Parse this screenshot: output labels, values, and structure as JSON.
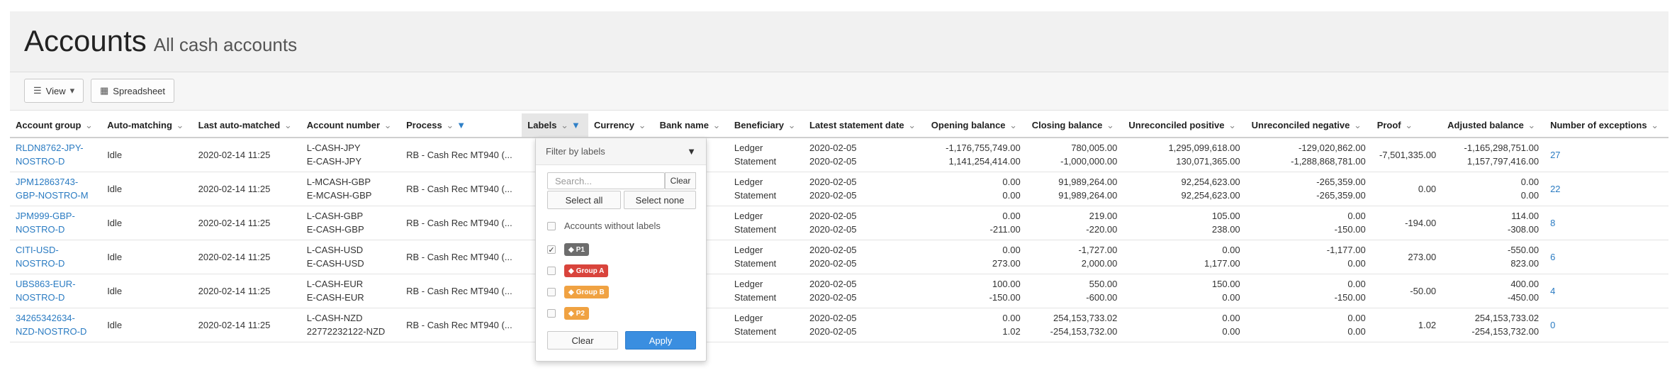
{
  "page": {
    "title": "Accounts",
    "subtitle": "All cash accounts"
  },
  "toolbar": {
    "view_label": "View",
    "spreadsheet_label": "Spreadsheet"
  },
  "columns": [
    "Account group",
    "Auto-matching",
    "Last auto-matched",
    "Account number",
    "Process",
    "Labels",
    "Currency",
    "Bank name",
    "Beneficiary",
    "Latest statement date",
    "Opening balance",
    "Closing balance",
    "Unreconciled positive",
    "Unreconciled negative",
    "Proof",
    "Adjusted balance",
    "Number of exceptions"
  ],
  "rows": [
    {
      "group": [
        "RLDN8762-JPY-",
        "NOSTRO-D"
      ],
      "auto": "Idle",
      "last": "2020-02-14 11:25",
      "acct": [
        "L-CASH-JPY",
        "E-CASH-JPY"
      ],
      "process": "RB - Cash Rec MT940 (...",
      "beneficiary": [
        "Ledger",
        "Statement"
      ],
      "date": [
        "2020-02-05",
        "2020-02-05"
      ],
      "opening": [
        "-1,176,755,749.00",
        "1,141,254,414.00"
      ],
      "closing": [
        "780,005.00",
        "-1,000,000.00"
      ],
      "upos": [
        "1,295,099,618.00",
        "130,071,365.00"
      ],
      "uneg": [
        "-129,020,862.00",
        "-1,288,868,781.00"
      ],
      "proof": "-7,501,335.00",
      "adjusted": [
        "-1,165,298,751.00",
        "1,157,797,416.00"
      ],
      "exceptions": "27"
    },
    {
      "group": [
        "JPM12863743-",
        "GBP-NOSTRO-M"
      ],
      "auto": "Idle",
      "last": "2020-02-14 11:25",
      "acct": [
        "L-MCASH-GBP",
        "E-MCASH-GBP"
      ],
      "process": "RB - Cash Rec MT940 (...",
      "beneficiary": [
        "Ledger",
        "Statement"
      ],
      "date": [
        "2020-02-05",
        "2020-02-05"
      ],
      "opening": [
        "0.00",
        "0.00"
      ],
      "closing": [
        "91,989,264.00",
        "91,989,264.00"
      ],
      "upos": [
        "92,254,623.00",
        "92,254,623.00"
      ],
      "uneg": [
        "-265,359.00",
        "-265,359.00"
      ],
      "proof": "0.00",
      "adjusted": [
        "0.00",
        "0.00"
      ],
      "exceptions": "22"
    },
    {
      "group": [
        "JPM999-GBP-",
        "NOSTRO-D"
      ],
      "auto": "Idle",
      "last": "2020-02-14 11:25",
      "acct": [
        "L-CASH-GBP",
        "E-CASH-GBP"
      ],
      "process": "RB - Cash Rec MT940 (...",
      "beneficiary": [
        "Ledger",
        "Statement"
      ],
      "date": [
        "2020-02-05",
        "2020-02-05"
      ],
      "opening": [
        "0.00",
        "-211.00"
      ],
      "closing": [
        "219.00",
        "-220.00"
      ],
      "upos": [
        "105.00",
        "238.00"
      ],
      "uneg": [
        "0.00",
        "-150.00"
      ],
      "proof": "-194.00",
      "adjusted": [
        "114.00",
        "-308.00"
      ],
      "exceptions": "8"
    },
    {
      "group": [
        "CITI-USD-",
        "NOSTRO-D"
      ],
      "auto": "Idle",
      "last": "2020-02-14 11:25",
      "acct": [
        "L-CASH-USD",
        "E-CASH-USD"
      ],
      "process": "RB - Cash Rec MT940 (...",
      "beneficiary": [
        "Ledger",
        "Statement"
      ],
      "date": [
        "2020-02-05",
        "2020-02-05"
      ],
      "opening": [
        "0.00",
        "273.00"
      ],
      "closing": [
        "-1,727.00",
        "2,000.00"
      ],
      "upos": [
        "0.00",
        "1,177.00"
      ],
      "uneg": [
        "-1,177.00",
        "0.00"
      ],
      "proof": "273.00",
      "adjusted": [
        "-550.00",
        "823.00"
      ],
      "exceptions": "6"
    },
    {
      "group": [
        "UBS863-EUR-",
        "NOSTRO-D"
      ],
      "auto": "Idle",
      "last": "2020-02-14 11:25",
      "acct": [
        "L-CASH-EUR",
        "E-CASH-EUR"
      ],
      "process": "RB - Cash Rec MT940 (...",
      "beneficiary": [
        "Ledger",
        "Statement"
      ],
      "date": [
        "2020-02-05",
        "2020-02-05"
      ],
      "opening": [
        "100.00",
        "-150.00"
      ],
      "closing": [
        "550.00",
        "-600.00"
      ],
      "upos": [
        "150.00",
        "0.00"
      ],
      "uneg": [
        "0.00",
        "-150.00"
      ],
      "proof": "-50.00",
      "adjusted": [
        "400.00",
        "-450.00"
      ],
      "exceptions": "4"
    },
    {
      "group": [
        "34265342634-",
        "NZD-NOSTRO-D"
      ],
      "auto": "Idle",
      "last": "2020-02-14 11:25",
      "acct": [
        "L-CASH-NZD",
        "22772232122-NZD"
      ],
      "process": "RB - Cash Rec MT940 (...",
      "beneficiary": [
        "Ledger",
        "Statement"
      ],
      "date": [
        "2020-02-05",
        "2020-02-05"
      ],
      "opening": [
        "0.00",
        "1.02"
      ],
      "closing": [
        "254,153,733.02",
        "-254,153,732.00"
      ],
      "upos": [
        "0.00",
        "0.00"
      ],
      "uneg": [
        "0.00",
        "0.00"
      ],
      "proof": "1.02",
      "adjusted": [
        "254,153,733.02",
        "-254,153,732.00"
      ],
      "exceptions": "0"
    }
  ],
  "label_filter": {
    "title": "Filter by labels",
    "search_placeholder": "Search...",
    "clear_small": "Clear",
    "select_all": "Select all",
    "select_none": "Select none",
    "no_labels": "Accounts without labels",
    "tags": [
      {
        "text": "P1",
        "color": "#6d6d6d",
        "checked": true
      },
      {
        "text": "Group A",
        "color": "#d9443c",
        "checked": false
      },
      {
        "text": "Group B",
        "color": "#f0a242",
        "checked": false
      },
      {
        "text": "P2",
        "color": "#f0a242",
        "checked": false
      }
    ],
    "clear_button": "Clear",
    "apply_button": "Apply"
  }
}
